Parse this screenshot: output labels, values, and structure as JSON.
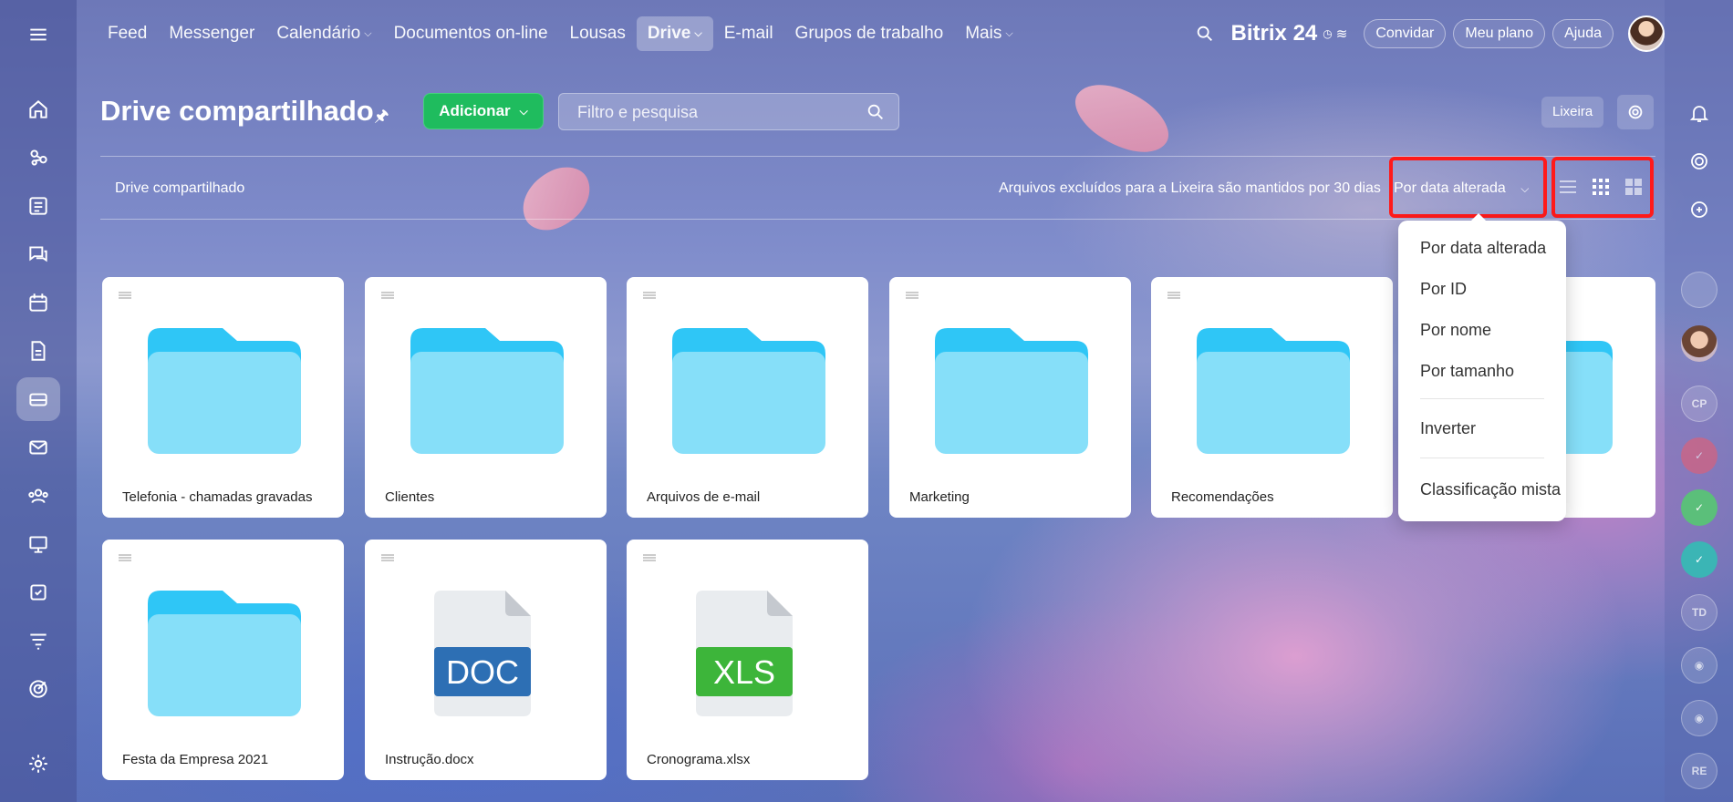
{
  "nav": {
    "tabs": [
      {
        "label": "Feed"
      },
      {
        "label": "Messenger"
      },
      {
        "label": "Calendário"
      },
      {
        "label": "Documentos on-line"
      },
      {
        "label": "Lousas"
      },
      {
        "label": "Drive"
      },
      {
        "label": "E-mail"
      },
      {
        "label": "Grupos de trabalho"
      },
      {
        "label": "Mais"
      }
    ],
    "active": "Drive"
  },
  "topbar": {
    "brand": "Bitrix 24",
    "invite": "Convidar",
    "plan": "Meu plano",
    "help": "Ajuda"
  },
  "header": {
    "title": "Drive compartilhado",
    "add_label": "Adicionar",
    "search_placeholder": "Filtro e pesquisa",
    "trash_label": "Lixeira"
  },
  "toolbar": {
    "breadcrumb": "Drive compartilhado",
    "notice": "Arquivos excluídos para a Lixeira são mantidos por 30 dias",
    "sort_label": "Por data alterada"
  },
  "sort_menu": {
    "items": [
      "Por data alterada",
      "Por ID",
      "Por nome",
      "Por tamanho"
    ],
    "invert": "Inverter",
    "mixed": "Classificação mista"
  },
  "files": [
    {
      "name": "Telefonia - chamadas gravadas",
      "type": "folder"
    },
    {
      "name": "Clientes",
      "type": "folder"
    },
    {
      "name": "Arquivos de e-mail",
      "type": "folder"
    },
    {
      "name": "Marketing",
      "type": "folder"
    },
    {
      "name": "Recomendações",
      "type": "folder"
    },
    {
      "name": "",
      "type": "folder"
    },
    {
      "name": "Festa da Empresa 2021",
      "type": "folder"
    },
    {
      "name": "Instrução.docx",
      "type": "doc",
      "badge": "DOC"
    },
    {
      "name": "Cronograma.xlsx",
      "type": "xls",
      "badge": "XLS"
    }
  ],
  "rightbar": {
    "initials": [
      "CP",
      "TD",
      "RE"
    ]
  },
  "colors": {
    "add_button": "#1fbc5e",
    "folder_light": "#86dff9",
    "folder_dark": "#2fc6f6",
    "doc_badge": "#2d6fb4",
    "xls_badge": "#3db53a",
    "highlight": "#ff1a1a"
  }
}
